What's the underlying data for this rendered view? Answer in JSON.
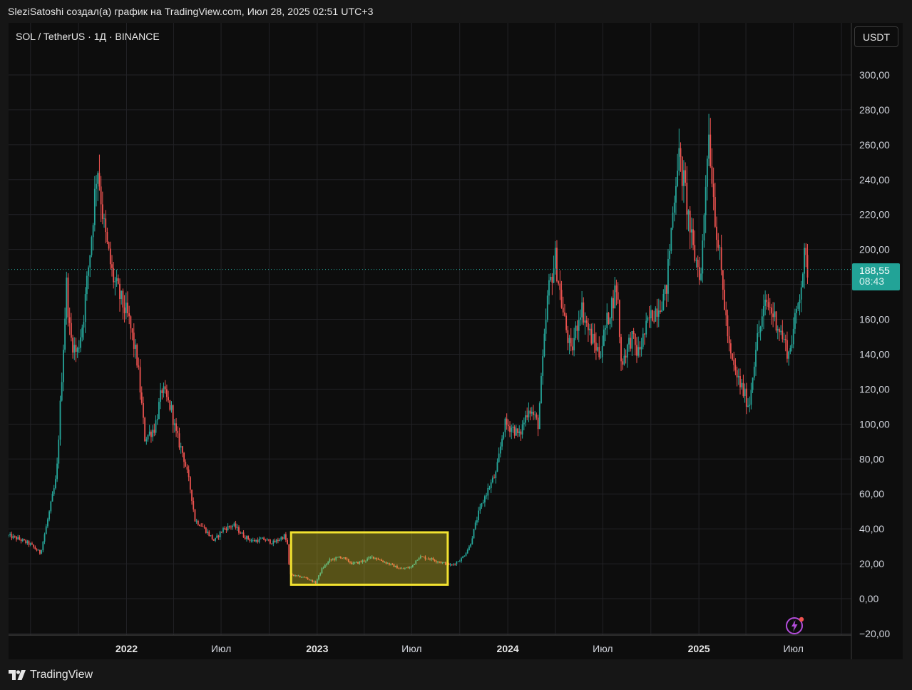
{
  "caption": "SleziSatoshi создал(а) график на TradingView.com, Июл 28, 2025 02:51 UTC+3",
  "legend": {
    "symbol": "SOL / TetherUS · 1Д · BINANCE"
  },
  "currency_button": "USDT",
  "price_badge": {
    "price": "188,55",
    "countdown": "08:43"
  },
  "footer": {
    "brand": "TradingView"
  },
  "icons": {
    "lightning": "lightning-icon",
    "logo": "tradingview-logo-icon"
  },
  "colors": {
    "up": "#26a69a",
    "down": "#ef5350",
    "highlight": "#f2e230",
    "badge": "#22a397"
  },
  "chart_data": {
    "type": "line",
    "title": "",
    "xlabel": "",
    "ylabel": "",
    "ylim": [
      -20,
      310
    ],
    "xlim": [
      "2021-05-20",
      "2025-10-20"
    ],
    "y_ticks": [
      {
        "value": 300,
        "label": "300,00"
      },
      {
        "value": 280,
        "label": "280,00"
      },
      {
        "value": 260,
        "label": "260,00"
      },
      {
        "value": 240,
        "label": "240,00"
      },
      {
        "value": 220,
        "label": "220,00"
      },
      {
        "value": 200,
        "label": "200,00"
      },
      {
        "value": 160,
        "label": "160,00"
      },
      {
        "value": 140,
        "label": "140,00"
      },
      {
        "value": 120,
        "label": "120,00"
      },
      {
        "value": 100,
        "label": "100,00"
      },
      {
        "value": 80,
        "label": "80,00"
      },
      {
        "value": 60,
        "label": "60,00"
      },
      {
        "value": 40,
        "label": "40,00"
      },
      {
        "value": 20,
        "label": "20,00"
      },
      {
        "value": 0,
        "label": "0,00"
      },
      {
        "value": -20,
        "label": "−20,00"
      }
    ],
    "x_ticks": [
      {
        "date": "2022-01-01",
        "label": "2022",
        "year": true
      },
      {
        "date": "2022-07-01",
        "label": "Июл",
        "year": false
      },
      {
        "date": "2023-01-01",
        "label": "2023",
        "year": true
      },
      {
        "date": "2023-07-01",
        "label": "Июл",
        "year": false
      },
      {
        "date": "2024-01-01",
        "label": "2024",
        "year": true
      },
      {
        "date": "2024-07-01",
        "label": "Июл",
        "year": false
      },
      {
        "date": "2025-01-01",
        "label": "2025",
        "year": true
      },
      {
        "date": "2025-07-01",
        "label": "Июл",
        "year": false
      }
    ],
    "last_price": 188.55,
    "series": [
      {
        "x": [
          "2021-05-20",
          "2021-06-10",
          "2021-07-01",
          "2021-07-20",
          "2021-08-05",
          "2021-08-20",
          "2021-09-08",
          "2021-09-15",
          "2021-09-28",
          "2021-10-10",
          "2021-10-25",
          "2021-11-06",
          "2021-11-20",
          "2021-12-05",
          "2021-12-20",
          "2022-01-05",
          "2022-01-22",
          "2022-02-05",
          "2022-02-24",
          "2022-03-10",
          "2022-03-28",
          "2022-04-05",
          "2022-04-20",
          "2022-05-05",
          "2022-05-12",
          "2022-05-25",
          "2022-06-18",
          "2022-07-05",
          "2022-07-25",
          "2022-08-13",
          "2022-08-30",
          "2022-09-20",
          "2022-10-10",
          "2022-10-30",
          "2022-11-06",
          "2022-11-09",
          "2022-11-20",
          "2022-12-10",
          "2022-12-29",
          "2023-01-10",
          "2023-01-25",
          "2023-02-15",
          "2023-03-10",
          "2023-03-25",
          "2023-04-18",
          "2023-05-10",
          "2023-06-10",
          "2023-06-30",
          "2023-07-14",
          "2023-08-05",
          "2023-08-25",
          "2023-09-15",
          "2023-10-05",
          "2023-10-20",
          "2023-11-05",
          "2023-11-20",
          "2023-12-10",
          "2023-12-25",
          "2024-01-10",
          "2024-01-23",
          "2024-02-10",
          "2024-02-28",
          "2024-03-18",
          "2024-04-01",
          "2024-04-15",
          "2024-05-01",
          "2024-05-20",
          "2024-06-05",
          "2024-06-25",
          "2024-07-10",
          "2024-07-28",
          "2024-08-05",
          "2024-08-25",
          "2024-09-06",
          "2024-09-28",
          "2024-10-15",
          "2024-10-30",
          "2024-11-10",
          "2024-11-22",
          "2024-12-05",
          "2024-12-20",
          "2025-01-05",
          "2025-01-19",
          "2025-02-01",
          "2025-02-15",
          "2025-03-01",
          "2025-03-11",
          "2025-03-25",
          "2025-04-07",
          "2025-04-20",
          "2025-05-10",
          "2025-05-28",
          "2025-06-10",
          "2025-06-22",
          "2025-07-05",
          "2025-07-15",
          "2025-07-22",
          "2025-07-28"
        ],
        "values": [
          36,
          34,
          31,
          26,
          48,
          70,
          180,
          150,
          140,
          160,
          205,
          250,
          210,
          185,
          172,
          160,
          135,
          92,
          98,
          120,
          108,
          95,
          82,
          60,
          45,
          42,
          33,
          40,
          42,
          36,
          33,
          34,
          32,
          36,
          30,
          14,
          13,
          12,
          9,
          17,
          22,
          24,
          20,
          21,
          24,
          21,
          17,
          18,
          24,
          23,
          21,
          19,
          23,
          30,
          48,
          60,
          72,
          100,
          98,
          93,
          110,
          100,
          175,
          195,
          165,
          140,
          168,
          152,
          140,
          160,
          180,
          135,
          150,
          140,
          160,
          168,
          175,
          215,
          255,
          235,
          200,
          185,
          270,
          220,
          180,
          140,
          130,
          120,
          110,
          145,
          170,
          160,
          150,
          140,
          160,
          180,
          195,
          188.55
        ]
      }
    ],
    "annotations": [
      {
        "type": "rectangle",
        "x0": "2022-11-12",
        "x1": "2023-09-08",
        "y0": 8,
        "y1": 38
      }
    ]
  }
}
